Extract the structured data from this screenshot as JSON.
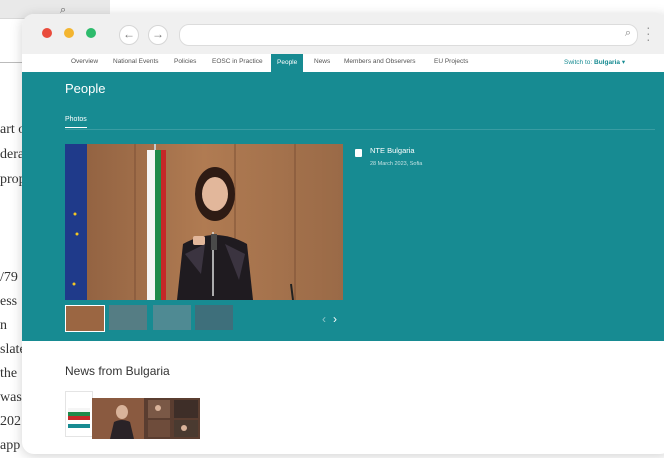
{
  "background_doc": {
    "lines": [
      "art o",
      "dera",
      "prop",
      "/79",
      "ess",
      "n",
      "slate",
      "the",
      "was",
      "202",
      "app"
    ]
  },
  "browser": {
    "url": "",
    "icons": {
      "back": "arrow-left-icon",
      "forward": "arrow-right-icon",
      "search": "search-icon",
      "menu": "kebab-menu-icon"
    }
  },
  "nav": {
    "items": [
      "Overview",
      "National Events",
      "Policies",
      "EOSC in Practice",
      "People",
      "News",
      "Members and Observers",
      "EU Projects"
    ],
    "active": "People",
    "switch_label": "Switch to:",
    "switch_value": "Bulgaria",
    "switch_caret": "▾"
  },
  "people": {
    "title": "People",
    "tab": "Photos",
    "album": {
      "title": "NTE Bulgaria",
      "meta": "28 March 2023, Sofia"
    },
    "carousel": {
      "prev": "‹",
      "next": "›"
    }
  },
  "news": {
    "title": "News from Bulgaria"
  },
  "colors": {
    "teal": "#178b92",
    "chrome_bg": "#f0f0f0"
  }
}
